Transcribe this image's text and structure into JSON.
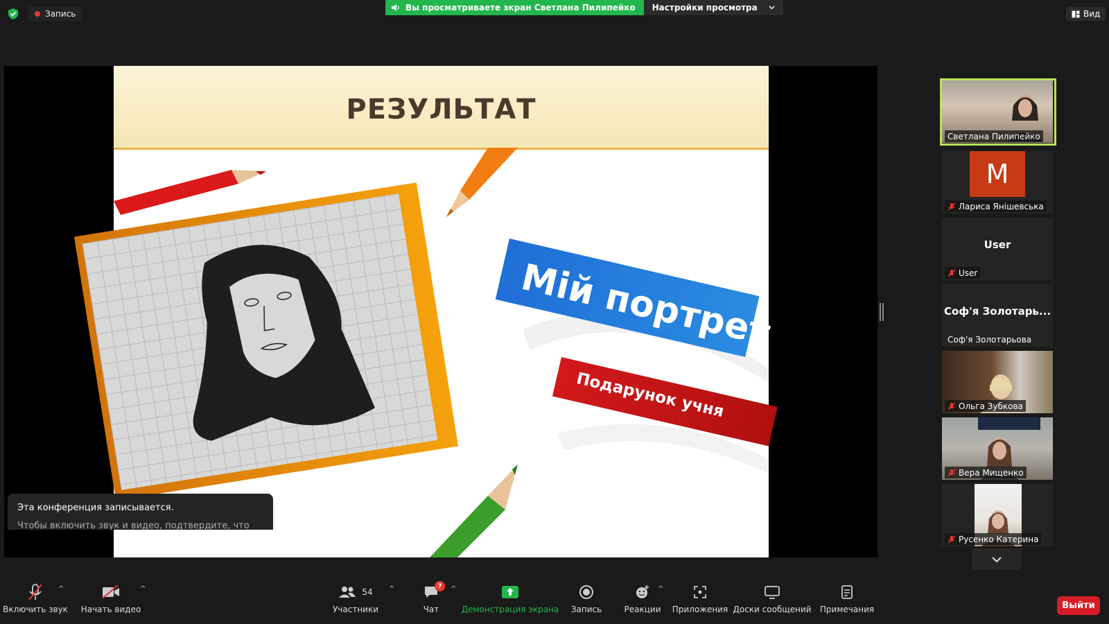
{
  "top": {
    "record_label": "Запись",
    "banner_text": "Вы просматриваете экран Светлана Пилипейко",
    "view_options_label": "Настройки просмотра",
    "view_label": "Вид"
  },
  "slide": {
    "title": "РЕЗУЛЬТАТ",
    "blue_text": "Мій портрет",
    "red_text": "Подарунок учня"
  },
  "toast": {
    "title": "Эта конференция записывается.",
    "body": "Чтобы включить звук и видео, подтвердите, что"
  },
  "participants": [
    {
      "name": "Светлана Пилипейко",
      "type": "video",
      "muted": false,
      "active": true
    },
    {
      "name": "Лариса Янішевська",
      "type": "avatar",
      "avatar_letter": "M",
      "avatar_color": "#c63b15",
      "muted": true
    },
    {
      "name": "User",
      "type": "name",
      "center_text": "User",
      "muted": true
    },
    {
      "name": "Соф'я Золотарьова",
      "type": "name",
      "center_text": "Соф'я Золотарь...",
      "muted": false
    },
    {
      "name": "Ольга Зубкова",
      "type": "video",
      "muted": true
    },
    {
      "name": "Вера Мищенко",
      "type": "video",
      "muted": true
    },
    {
      "name": "Русенко Катерина",
      "type": "video",
      "muted": true
    }
  ],
  "toolbar": {
    "audio_label": "Включить звук",
    "video_label": "Начать видео",
    "participants_label": "Участники",
    "participants_count": "54",
    "chat_label": "Чат",
    "chat_badge": "7",
    "share_label": "Демонстрация экрана",
    "record_label": "Запись",
    "reactions_label": "Реакции",
    "apps_label": "Приложения",
    "whiteboards_label": "Доски сообщений",
    "notes_label": "Примечания",
    "leave_label": "Выйти"
  },
  "colors": {
    "share_green": "#23b64d",
    "leave_red": "#d51d27",
    "active_speaker": "#b7e256"
  }
}
